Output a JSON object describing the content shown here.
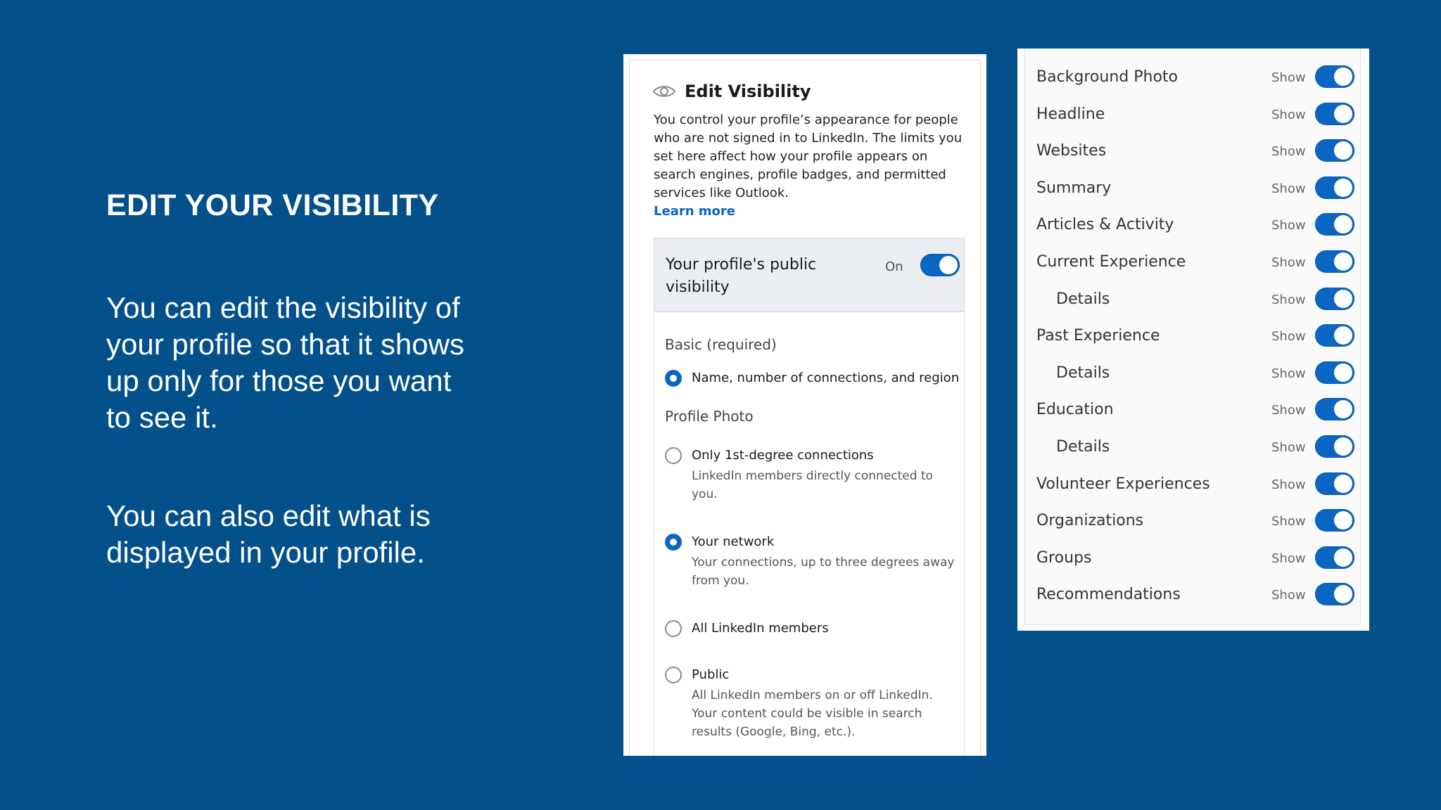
{
  "slide": {
    "title": "EDIT YOUR VISIBILITY",
    "paragraph1": "You can edit the visibility of your profile so that it shows up only for those you want to see it.",
    "paragraph2": "You can also edit what is displayed in your profile."
  },
  "edit_visibility": {
    "title": "Edit Visibility",
    "description": "You control your profile’s appearance for people who are not signed in to LinkedIn. The limits you set here affect how your profile appears on search engines, profile badges, and permitted services like Outlook.",
    "learn_more": "Learn more",
    "public_visibility": {
      "label": "Your profile's public visibility",
      "state_text": "On",
      "enabled": true
    },
    "basic_label": "Basic (required)",
    "basic_option": "Name, number of connections, and region",
    "profile_photo_label": "Profile Photo",
    "photo_options": [
      {
        "label": "Only 1st-degree connections",
        "sub": "LinkedIn members directly connected to you.",
        "checked": false
      },
      {
        "label": "Your network",
        "sub": "Your connections, up to three degrees away from you.",
        "checked": true
      },
      {
        "label": "All LinkedIn members",
        "sub": "",
        "checked": false
      },
      {
        "label": "Public",
        "sub": "All LinkedIn members on or off LinkedIn. Your content could be visible in search results (Google, Bing, etc.).",
        "checked": false
      }
    ]
  },
  "sections": {
    "show_label": "Show",
    "items": [
      {
        "label": "Background Photo",
        "indent": false,
        "on": true
      },
      {
        "label": "Headline",
        "indent": false,
        "on": true
      },
      {
        "label": "Websites",
        "indent": false,
        "on": true
      },
      {
        "label": "Summary",
        "indent": false,
        "on": true
      },
      {
        "label": "Articles & Activity",
        "indent": false,
        "on": true
      },
      {
        "label": "Current Experience",
        "indent": false,
        "on": true
      },
      {
        "label": "Details",
        "indent": true,
        "on": true
      },
      {
        "label": "Past Experience",
        "indent": false,
        "on": true
      },
      {
        "label": "Details",
        "indent": true,
        "on": true
      },
      {
        "label": "Education",
        "indent": false,
        "on": true
      },
      {
        "label": "Details",
        "indent": true,
        "on": true
      },
      {
        "label": "Volunteer Experiences",
        "indent": false,
        "on": true
      },
      {
        "label": "Organizations",
        "indent": false,
        "on": true
      },
      {
        "label": "Groups",
        "indent": false,
        "on": true
      },
      {
        "label": "Recommendations",
        "indent": false,
        "on": true
      }
    ]
  },
  "colors": {
    "background": "#03508a",
    "accent": "#0a66c2"
  }
}
